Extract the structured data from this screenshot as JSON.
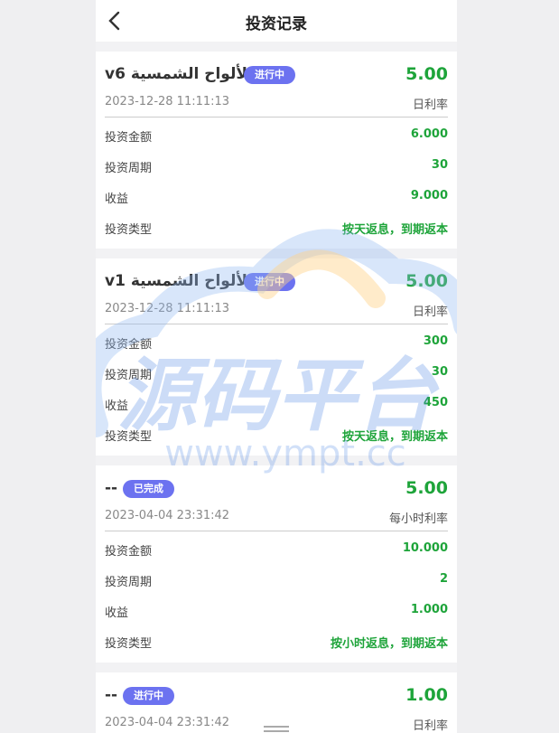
{
  "header": {
    "title": "投资记录"
  },
  "labels": {
    "amount": "投资金额",
    "period": "投资周期",
    "income": "收益",
    "type": "投资类型"
  },
  "records": [
    {
      "name": "الألواح الشمسية v6",
      "status": "进行中",
      "rate": "5.00",
      "date": "2023-12-28 11:11:13",
      "rate_label": "日利率",
      "amount": "6.000",
      "period": "30",
      "income": "9.000",
      "type": "按天返息，到期返本"
    },
    {
      "name": "الألواح الشمسية v1",
      "status": "进行中",
      "rate": "5.00",
      "date": "2023-12-28 11:11:13",
      "rate_label": "日利率",
      "amount": "300",
      "period": "30",
      "income": "450",
      "type": "按天返息，到期返本"
    },
    {
      "name": "--",
      "status": "已完成",
      "rate": "5.00",
      "date": "2023-04-04 23:31:42",
      "rate_label": "每小时利率",
      "amount": "10.000",
      "period": "2",
      "income": "1.000",
      "type": "按小时返息，到期返本"
    },
    {
      "name": "--",
      "status": "进行中",
      "rate": "1.00",
      "date": "2023-04-04 23:31:42",
      "rate_label": "日利率"
    }
  ],
  "watermark": {
    "text_cn": "源码平台",
    "text_en": "www.ympt.cc"
  },
  "colors": {
    "accent_green": "#1ea43a",
    "badge": "#6c72f0",
    "background": "#f2f2f4"
  }
}
